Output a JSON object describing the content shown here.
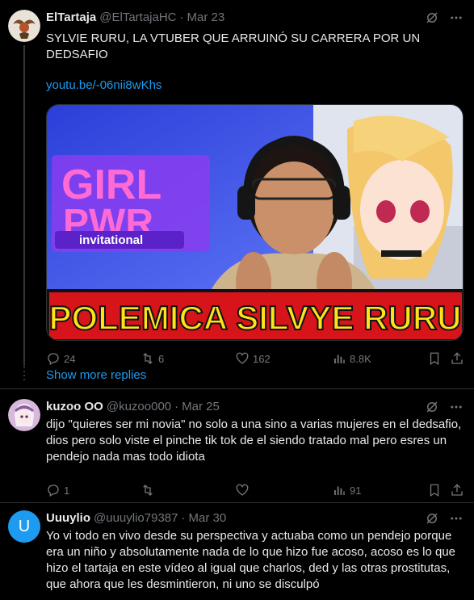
{
  "tweets": [
    {
      "name": "ElTartaja",
      "handle": "@ElTartajaHC",
      "dot": "·",
      "date": "Mar 23",
      "text": "SYLVIE RURU, LA VTUBER QUE ARRUINÓ SU CARRERA POR UN DEDSAFIO",
      "link": "youtu.be/-06nii8wKhs",
      "media": {
        "logo_top": "GIRL",
        "logo_bottom": "PWR",
        "logo_sub": "invitational",
        "banner": "POLEMICA SILVYE RURU"
      },
      "actions": {
        "replies": "24",
        "retweets": "6",
        "likes": "162",
        "views": "8.8K"
      }
    },
    {
      "name": "kuzoo OO",
      "handle": "@kuzoo000",
      "dot": "·",
      "date": "Mar 25",
      "text": "dijo \"quieres ser mi novia\" no solo a una sino a varias mujeres en el dedsafio, dios pero solo viste el pinche tik tok de el siendo tratado mal pero esres un pendejo nada mas todo idiota",
      "actions": {
        "replies": "1",
        "retweets": "",
        "likes": "",
        "views": "91"
      }
    },
    {
      "name": "Uuuylio",
      "handle": "@uuuylio79387",
      "dot": "·",
      "date": "Mar 30",
      "avatar_letter": "U",
      "text": "Yo vi todo en vivo desde su perspectiva y actuaba como un pendejo porque era un niño y absolutamente nada de lo que hizo fue acoso, acoso es lo que hizo el tartaja en este vídeo al igual que charlos, ded y las otras prostitutas, que ahora que les desmintieron, ni uno se disculpó"
    }
  ],
  "show_more": "Show more replies",
  "colors": {
    "accent": "#1d9bf0",
    "muted": "#71767b",
    "bg": "#000000",
    "text": "#e7e9ea"
  }
}
